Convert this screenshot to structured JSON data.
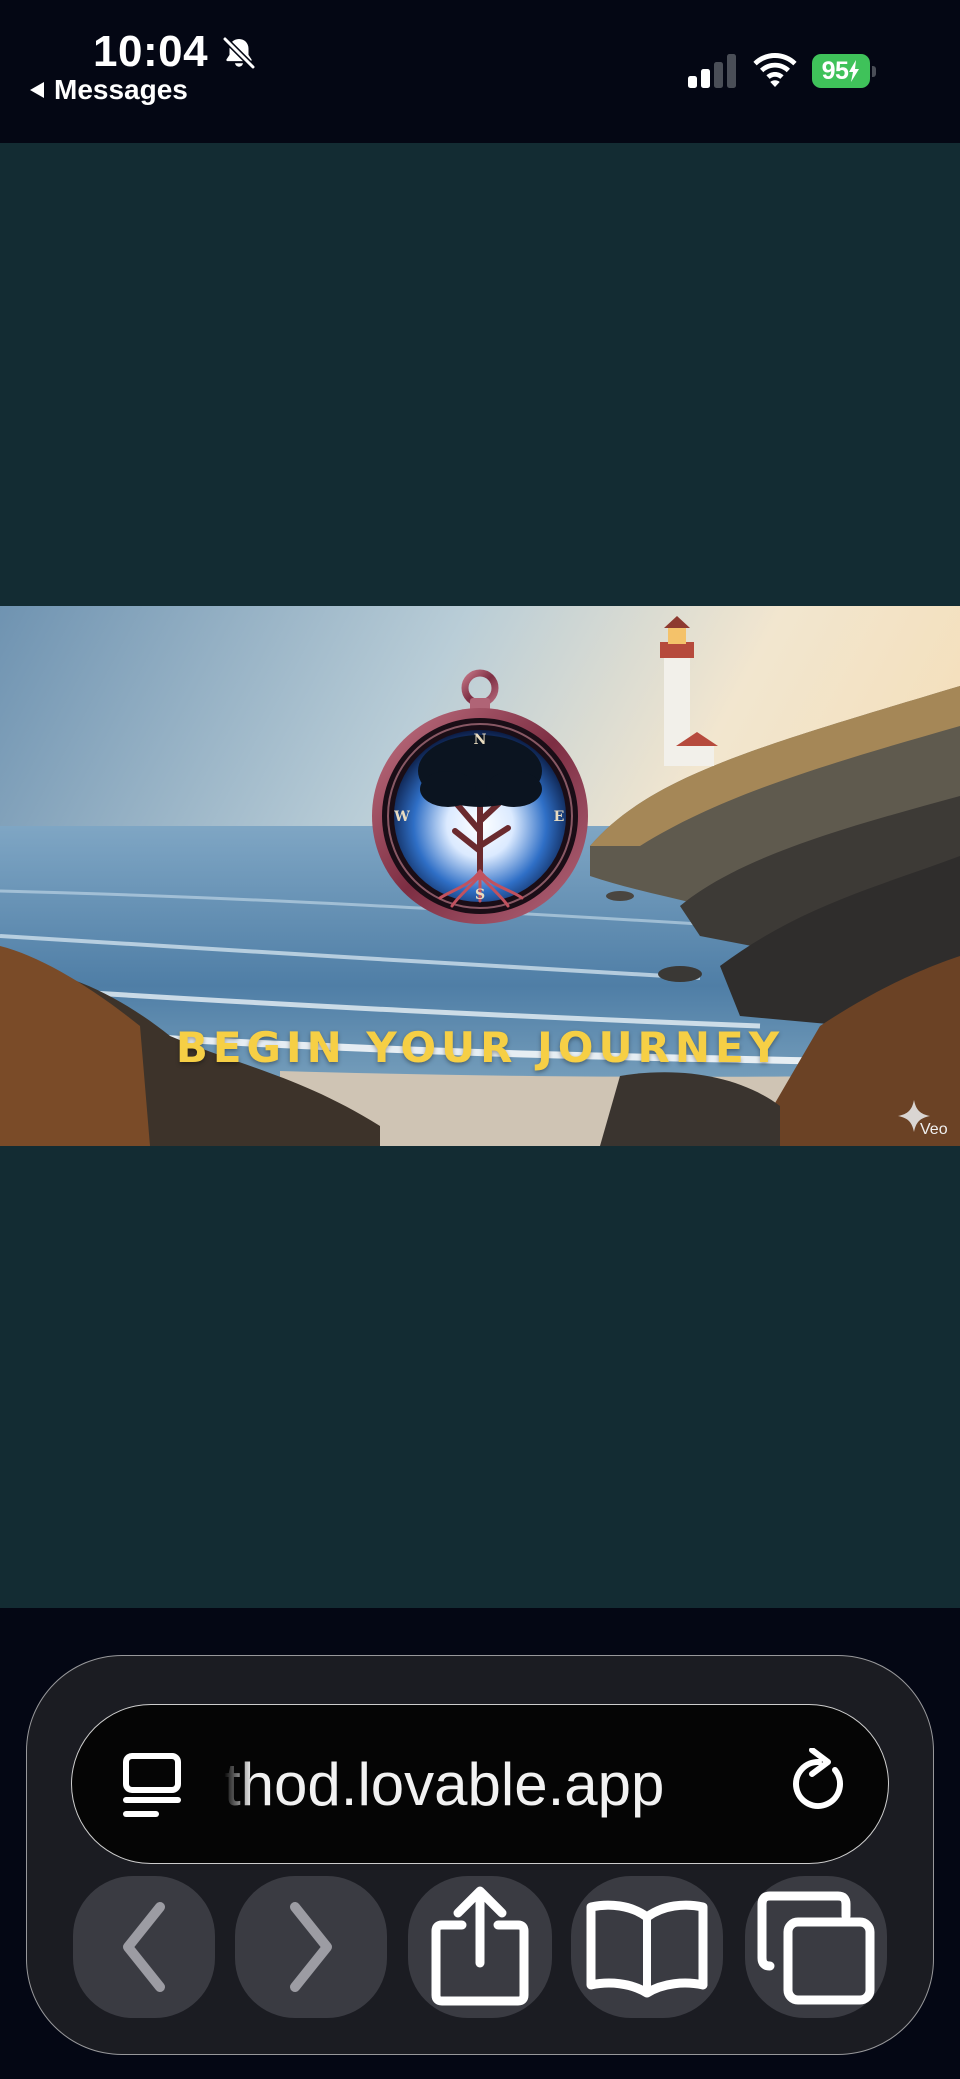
{
  "status_bar": {
    "time": "10:04",
    "back_label": "Messages",
    "battery_percent": "95",
    "signal_bars_active": 2,
    "signal_bars_total": 4,
    "icons": [
      "bell-slash-icon",
      "cellular-signal-icon",
      "wifi-icon",
      "battery-charging-icon"
    ]
  },
  "page": {
    "background_color": "#132c33",
    "hero": {
      "cta_label": "BEGIN YOUR JOURNEY",
      "cta_color": "#f6cf45",
      "compass_letters": [
        "N",
        "E",
        "S",
        "W"
      ],
      "veo_label": "Veo"
    }
  },
  "browser": {
    "url": "thod.lovable.app",
    "buttons": {
      "back": "chevron-left-icon",
      "forward": "chevron-right-icon",
      "share": "share-icon",
      "bookmarks": "book-icon",
      "tabs": "tabs-icon"
    }
  }
}
